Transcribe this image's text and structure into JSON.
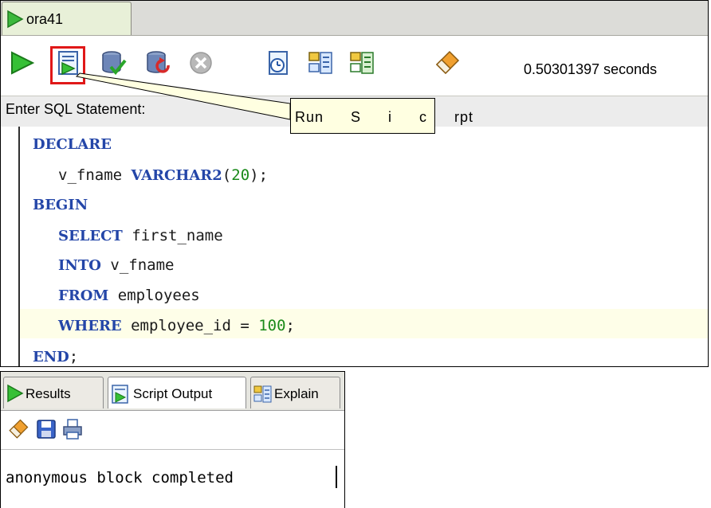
{
  "connection_tab": {
    "label": "ora41"
  },
  "toolbar": {
    "icons": [
      "run-statement-icon",
      "run-script-icon",
      "commit-icon",
      "rollback-icon",
      "cancel-icon",
      "sql-history-icon",
      "execute-explain-plan-icon",
      "autotrace-icon",
      "clear-icon"
    ],
    "timing": "0.50301397 seconds"
  },
  "sql_label": "Enter SQL Statement:",
  "tooltip": {
    "text": "Run S i c rpt"
  },
  "code": {
    "line1_kw": "DECLARE",
    "line2_pre": "v_fname ",
    "line2_kw": "VARCHAR2",
    "line2_paren_open": "(",
    "line2_num": "20",
    "line2_post": ");",
    "line3_kw": "BEGIN",
    "line4_kw": "SELECT",
    "line4_rest": " first_name",
    "line5_kw": "INTO",
    "line5_rest": " v_fname",
    "line6_kw": "FROM",
    "line6_rest": " employees",
    "line7_kw": "WHERE",
    "line7_rest": " employee_id = ",
    "line7_num": "100",
    "line7_end": ";",
    "line8_kw": "END",
    "line8_end": ";"
  },
  "output": {
    "tabs": [
      {
        "label": "Results",
        "icon": "run-icon"
      },
      {
        "label": "Script Output",
        "icon": "script-icon",
        "active": true
      },
      {
        "label": "Explain",
        "icon": "explain-icon"
      }
    ],
    "toolbar_icons": [
      "eraser-icon",
      "save-icon",
      "print-icon"
    ],
    "text": "anonymous block completed"
  },
  "colors": {
    "keyword": "#2446a8",
    "number": "#1a8a1a",
    "run_green": "#2aa52a",
    "highlight_red": "#e01818",
    "tooltip_bg": "#ffffe1",
    "current_line_bg": "#fefee8"
  }
}
